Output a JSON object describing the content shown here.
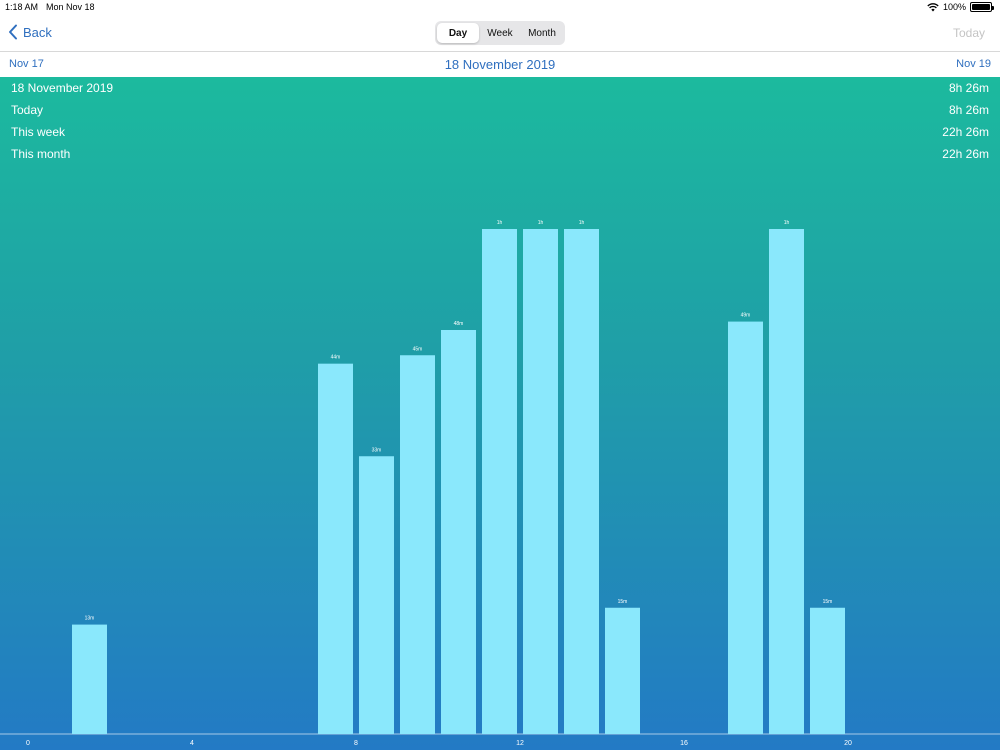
{
  "status": {
    "time": "1:18 AM",
    "date": "Mon Nov 18",
    "battery": "100%"
  },
  "nav": {
    "back_label": "Back",
    "segments": [
      {
        "label": "Day",
        "active": true
      },
      {
        "label": "Week",
        "active": false
      },
      {
        "label": "Month",
        "active": false
      }
    ],
    "today_label": "Today"
  },
  "date_nav": {
    "prev": "Nov 17",
    "current": "18 November 2019",
    "next": "Nov 19"
  },
  "summary": [
    {
      "label": "18 November 2019",
      "value": "8h 26m"
    },
    {
      "label": "Today",
      "value": "8h 26m"
    },
    {
      "label": "This week",
      "value": "22h 26m"
    },
    {
      "label": "This month",
      "value": "22h 26m"
    }
  ],
  "colors": {
    "accent": "#2f6fbf",
    "bar": "#8ae8fc",
    "gradient_top": "#1cba9e",
    "gradient_bottom": "#237ac5"
  },
  "chart_data": {
    "type": "bar",
    "x_ticks": [
      0,
      4,
      8,
      12,
      16,
      20
    ],
    "xlim": [
      0,
      24
    ],
    "ylim": [
      0,
      60
    ],
    "bars": [
      {
        "hour": 1,
        "minutes": 13,
        "label": "13m"
      },
      {
        "hour": 7,
        "minutes": 44,
        "label": "44m"
      },
      {
        "hour": 8,
        "minutes": 33,
        "label": "33m"
      },
      {
        "hour": 9,
        "minutes": 45,
        "label": "45m"
      },
      {
        "hour": 10,
        "minutes": 48,
        "label": "48m"
      },
      {
        "hour": 11,
        "minutes": 60,
        "label": "1h"
      },
      {
        "hour": 12,
        "minutes": 60,
        "label": "1h"
      },
      {
        "hour": 13,
        "minutes": 60,
        "label": "1h"
      },
      {
        "hour": 14,
        "minutes": 15,
        "label": "15m"
      },
      {
        "hour": 17,
        "minutes": 49,
        "label": "49m"
      },
      {
        "hour": 18,
        "minutes": 60,
        "label": "1h"
      },
      {
        "hour": 19,
        "minutes": 15,
        "label": "15m"
      }
    ]
  }
}
